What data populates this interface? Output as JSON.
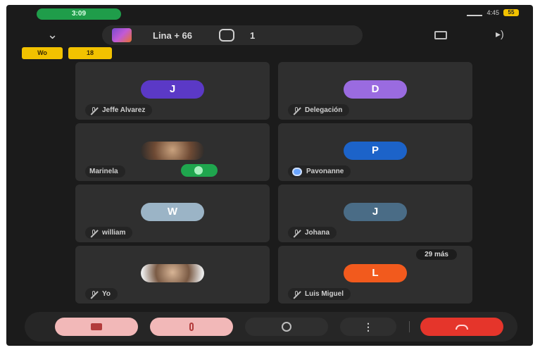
{
  "status_bar": {
    "call_timer": "3:09",
    "clock": "4:45",
    "battery": "55"
  },
  "top_bar": {
    "room_name": "Lina + 66",
    "participants_count": "1"
  },
  "tags": [
    "Wo",
    "18"
  ],
  "participants": [
    {
      "initial": "J",
      "name": "Jeffe Alvarez",
      "avatar_color": "#5b39c6",
      "muted": true
    },
    {
      "initial": "D",
      "name": "Delegación",
      "avatar_color": "#9a6be0",
      "muted": true
    },
    {
      "initial": "",
      "name": "Marinela",
      "avatar_color": "",
      "muted": false,
      "speaking": true
    },
    {
      "initial": "P",
      "name": "Pavonanne",
      "avatar_color": "#1c63c9",
      "muted": false
    },
    {
      "initial": "W",
      "name": "william",
      "avatar_color": "#9bb4c6",
      "muted": true
    },
    {
      "initial": "J",
      "name": "Johana",
      "avatar_color": "#4a6c86",
      "muted": true
    },
    {
      "initial": "",
      "name": "Yo",
      "avatar_color": "",
      "muted": true
    },
    {
      "initial": "L",
      "name": "Luis Miguel",
      "avatar_color": "#f25a1d",
      "muted": true
    }
  ],
  "more_participants": "29 más",
  "colors": {
    "background": "#1b1b1b",
    "tile": "#2f2f2f",
    "end_call": "#e5352b",
    "toggle_off": "#f2b8b8",
    "call_pill": "#1f9d4a",
    "tag": "#f2c200"
  }
}
